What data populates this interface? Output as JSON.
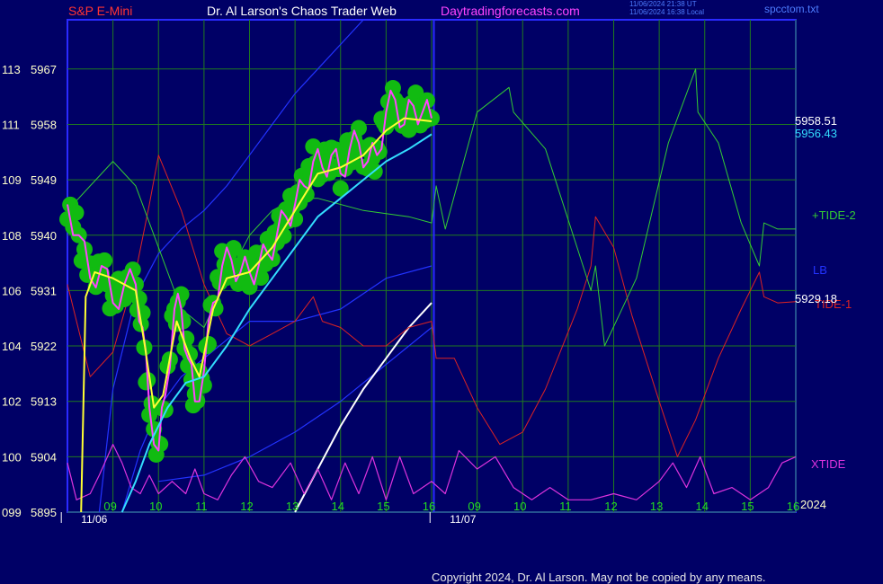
{
  "header": {
    "symbol": "S&P E-Mini",
    "author": "Dr. Al Larson's Chaos Trader Web",
    "site": "Daytradingforecasts.com",
    "stamp_utc": "11/06/2024 21:38 UT",
    "stamp_local": "11/06/2024 16:38 Local",
    "file": "spcctom.txt"
  },
  "copyright": "Copyright 2024, Dr. Al Larson. May not be copied by any means.",
  "colors": {
    "background": "#000066",
    "frame": "#2a2aff",
    "grid": "#1f7a1f",
    "price_bars": "#ff44ff",
    "price_glow": "#11bb11",
    "average_fast": "#ffff33",
    "average_slow": "#33ddff",
    "plus_tide": "#33cc33",
    "minus_tide": "#dd2222",
    "xtide": "#dd33dd",
    "lb": "#2233ff",
    "extension": "#ffffff",
    "axis_text": "#ffffcc"
  },
  "chart_data": {
    "type": "line",
    "y_ticks": [
      {
        "left": "099",
        "price": 5895
      },
      {
        "left": "100",
        "price": 5904
      },
      {
        "left": "102",
        "price": 5913
      },
      {
        "left": "104",
        "price": 5922
      },
      {
        "left": "106",
        "price": 5931
      },
      {
        "left": "108",
        "price": 5940
      },
      {
        "left": "109",
        "price": 5949
      },
      {
        "left": "111",
        "price": 5958
      },
      {
        "left": "113",
        "price": 5967
      }
    ],
    "ylim": [
      5895,
      5975
    ],
    "xlim": [
      8.0,
      24.0
    ],
    "hour_ticks": [
      {
        "x": 9,
        "label": "09"
      },
      {
        "x": 10,
        "label": "10"
      },
      {
        "x": 11,
        "label": "11"
      },
      {
        "x": 12,
        "label": "12"
      },
      {
        "x": 13,
        "label": "13"
      },
      {
        "x": 14,
        "label": "14"
      },
      {
        "x": 15,
        "label": "15"
      },
      {
        "x": 16,
        "label": "16"
      },
      {
        "x": 17,
        "label": "09"
      },
      {
        "x": 18,
        "label": "10"
      },
      {
        "x": 19,
        "label": "11"
      },
      {
        "x": 20,
        "label": "12"
      },
      {
        "x": 21,
        "label": "13"
      },
      {
        "x": 22,
        "label": "14"
      },
      {
        "x": 23,
        "label": "15"
      },
      {
        "x": 24,
        "label": "16"
      }
    ],
    "day_labels": [
      {
        "x": 8.3,
        "label": "11/06"
      },
      {
        "x": 16.4,
        "label": "11/07"
      }
    ],
    "day_divider_x": 16.05,
    "year_label": "2024",
    "price_series": [
      {
        "x": 8.0,
        "y": 5945
      },
      {
        "x": 8.25,
        "y": 5940
      },
      {
        "x": 8.5,
        "y": 5933
      },
      {
        "x": 8.75,
        "y": 5935
      },
      {
        "x": 9.0,
        "y": 5929
      },
      {
        "x": 9.25,
        "y": 5932
      },
      {
        "x": 9.5,
        "y": 5932
      },
      {
        "x": 9.65,
        "y": 5925
      },
      {
        "x": 9.8,
        "y": 5912
      },
      {
        "x": 10.0,
        "y": 5905
      },
      {
        "x": 10.15,
        "y": 5914
      },
      {
        "x": 10.35,
        "y": 5928
      },
      {
        "x": 10.5,
        "y": 5928
      },
      {
        "x": 10.65,
        "y": 5920
      },
      {
        "x": 10.8,
        "y": 5913
      },
      {
        "x": 11.0,
        "y": 5918
      },
      {
        "x": 11.2,
        "y": 5929
      },
      {
        "x": 11.4,
        "y": 5935
      },
      {
        "x": 11.6,
        "y": 5936
      },
      {
        "x": 11.8,
        "y": 5934
      },
      {
        "x": 12.0,
        "y": 5934
      },
      {
        "x": 12.2,
        "y": 5935
      },
      {
        "x": 12.4,
        "y": 5937
      },
      {
        "x": 12.6,
        "y": 5940
      },
      {
        "x": 12.8,
        "y": 5943
      },
      {
        "x": 13.0,
        "y": 5945
      },
      {
        "x": 13.2,
        "y": 5948
      },
      {
        "x": 13.4,
        "y": 5952
      },
      {
        "x": 13.6,
        "y": 5951
      },
      {
        "x": 13.8,
        "y": 5953
      },
      {
        "x": 14.0,
        "y": 5950
      },
      {
        "x": 14.2,
        "y": 5954
      },
      {
        "x": 14.4,
        "y": 5955
      },
      {
        "x": 14.6,
        "y": 5952
      },
      {
        "x": 14.8,
        "y": 5953
      },
      {
        "x": 15.0,
        "y": 5960
      },
      {
        "x": 15.2,
        "y": 5962
      },
      {
        "x": 15.4,
        "y": 5958
      },
      {
        "x": 15.6,
        "y": 5961
      },
      {
        "x": 15.8,
        "y": 5960
      },
      {
        "x": 16.0,
        "y": 5959
      }
    ],
    "average_fast": [
      {
        "x": 8.3,
        "y": 5895
      },
      {
        "x": 8.4,
        "y": 5930
      },
      {
        "x": 8.6,
        "y": 5934
      },
      {
        "x": 9.0,
        "y": 5933
      },
      {
        "x": 9.5,
        "y": 5931
      },
      {
        "x": 9.7,
        "y": 5922
      },
      {
        "x": 9.9,
        "y": 5912
      },
      {
        "x": 10.1,
        "y": 5914
      },
      {
        "x": 10.4,
        "y": 5926
      },
      {
        "x": 10.7,
        "y": 5920
      },
      {
        "x": 10.9,
        "y": 5917
      },
      {
        "x": 11.2,
        "y": 5928
      },
      {
        "x": 11.5,
        "y": 5933
      },
      {
        "x": 12.0,
        "y": 5934
      },
      {
        "x": 12.5,
        "y": 5938
      },
      {
        "x": 13.0,
        "y": 5944
      },
      {
        "x": 13.5,
        "y": 5950
      },
      {
        "x": 14.0,
        "y": 5951
      },
      {
        "x": 14.5,
        "y": 5953
      },
      {
        "x": 15.0,
        "y": 5957
      },
      {
        "x": 15.4,
        "y": 5959
      },
      {
        "x": 16.0,
        "y": 5958.5
      }
    ],
    "average_slow": [
      {
        "x": 9.2,
        "y": 5895
      },
      {
        "x": 9.5,
        "y": 5900
      },
      {
        "x": 9.8,
        "y": 5906
      },
      {
        "x": 10.2,
        "y": 5912
      },
      {
        "x": 10.6,
        "y": 5916
      },
      {
        "x": 11.0,
        "y": 5917
      },
      {
        "x": 11.5,
        "y": 5922
      },
      {
        "x": 12.0,
        "y": 5928
      },
      {
        "x": 12.5,
        "y": 5933
      },
      {
        "x": 13.0,
        "y": 5938
      },
      {
        "x": 13.5,
        "y": 5943
      },
      {
        "x": 14.0,
        "y": 5946
      },
      {
        "x": 14.5,
        "y": 5949
      },
      {
        "x": 15.0,
        "y": 5952
      },
      {
        "x": 15.5,
        "y": 5954
      },
      {
        "x": 16.0,
        "y": 5956.4
      }
    ],
    "plus_tide": [
      {
        "x": 8.0,
        "y": 5944
      },
      {
        "x": 8.5,
        "y": 5948
      },
      {
        "x": 9.0,
        "y": 5952
      },
      {
        "x": 9.5,
        "y": 5948
      },
      {
        "x": 10.0,
        "y": 5938
      },
      {
        "x": 10.5,
        "y": 5928
      },
      {
        "x": 11.0,
        "y": 5925
      },
      {
        "x": 11.5,
        "y": 5933
      },
      {
        "x": 12.0,
        "y": 5940
      },
      {
        "x": 12.5,
        "y": 5944
      },
      {
        "x": 13.0,
        "y": 5946
      },
      {
        "x": 13.5,
        "y": 5946
      },
      {
        "x": 14.5,
        "y": 5944
      },
      {
        "x": 15.5,
        "y": 5943
      },
      {
        "x": 16.0,
        "y": 5942
      },
      {
        "x": 16.1,
        "y": 5948
      },
      {
        "x": 16.3,
        "y": 5941
      },
      {
        "x": 17.0,
        "y": 5960
      },
      {
        "x": 17.7,
        "y": 5964
      },
      {
        "x": 17.8,
        "y": 5960
      },
      {
        "x": 18.5,
        "y": 5954
      },
      {
        "x": 19.5,
        "y": 5931
      },
      {
        "x": 19.6,
        "y": 5935
      },
      {
        "x": 19.8,
        "y": 5922
      },
      {
        "x": 20.5,
        "y": 5933
      },
      {
        "x": 21.2,
        "y": 5955
      },
      {
        "x": 21.8,
        "y": 5967
      },
      {
        "x": 21.85,
        "y": 5960
      },
      {
        "x": 22.3,
        "y": 5955
      },
      {
        "x": 22.8,
        "y": 5942
      },
      {
        "x": 23.2,
        "y": 5935
      },
      {
        "x": 23.3,
        "y": 5942
      },
      {
        "x": 23.6,
        "y": 5941
      },
      {
        "x": 24.0,
        "y": 5941
      }
    ],
    "minus_tide": [
      {
        "x": 8.0,
        "y": 5932
      },
      {
        "x": 8.5,
        "y": 5917
      },
      {
        "x": 9.0,
        "y": 5921
      },
      {
        "x": 9.5,
        "y": 5934
      },
      {
        "x": 9.8,
        "y": 5945
      },
      {
        "x": 10.0,
        "y": 5953
      },
      {
        "x": 10.5,
        "y": 5944
      },
      {
        "x": 11.0,
        "y": 5932
      },
      {
        "x": 11.5,
        "y": 5924
      },
      {
        "x": 12.0,
        "y": 5922
      },
      {
        "x": 12.5,
        "y": 5924
      },
      {
        "x": 13.0,
        "y": 5926
      },
      {
        "x": 13.4,
        "y": 5930
      },
      {
        "x": 13.6,
        "y": 5926
      },
      {
        "x": 14.0,
        "y": 5925
      },
      {
        "x": 14.5,
        "y": 5922
      },
      {
        "x": 15.0,
        "y": 5922
      },
      {
        "x": 15.5,
        "y": 5925
      },
      {
        "x": 16.0,
        "y": 5926
      },
      {
        "x": 16.1,
        "y": 5920
      },
      {
        "x": 16.5,
        "y": 5920
      },
      {
        "x": 17.0,
        "y": 5912
      },
      {
        "x": 17.5,
        "y": 5906
      },
      {
        "x": 18.0,
        "y": 5908
      },
      {
        "x": 18.5,
        "y": 5915
      },
      {
        "x": 19.2,
        "y": 5928
      },
      {
        "x": 19.5,
        "y": 5935
      },
      {
        "x": 19.6,
        "y": 5943
      },
      {
        "x": 20.0,
        "y": 5938
      },
      {
        "x": 20.4,
        "y": 5927
      },
      {
        "x": 21.0,
        "y": 5913
      },
      {
        "x": 21.4,
        "y": 5904
      },
      {
        "x": 21.8,
        "y": 5910
      },
      {
        "x": 22.3,
        "y": 5920
      },
      {
        "x": 22.8,
        "y": 5928
      },
      {
        "x": 23.2,
        "y": 5934
      },
      {
        "x": 23.3,
        "y": 5930
      },
      {
        "x": 23.6,
        "y": 5929
      },
      {
        "x": 24.0,
        "y": 5929.2
      }
    ],
    "xtide": [
      {
        "x": 8.0,
        "y": 5903
      },
      {
        "x": 8.2,
        "y": 5897
      },
      {
        "x": 8.5,
        "y": 5898
      },
      {
        "x": 8.7,
        "y": 5901
      },
      {
        "x": 9.0,
        "y": 5906
      },
      {
        "x": 9.2,
        "y": 5903
      },
      {
        "x": 9.4,
        "y": 5899
      },
      {
        "x": 9.6,
        "y": 5898
      },
      {
        "x": 9.8,
        "y": 5901
      },
      {
        "x": 10.0,
        "y": 5898
      },
      {
        "x": 10.3,
        "y": 5900
      },
      {
        "x": 10.6,
        "y": 5898
      },
      {
        "x": 10.8,
        "y": 5902
      },
      {
        "x": 11.0,
        "y": 5898
      },
      {
        "x": 11.3,
        "y": 5897
      },
      {
        "x": 11.6,
        "y": 5901
      },
      {
        "x": 11.9,
        "y": 5904
      },
      {
        "x": 12.2,
        "y": 5900
      },
      {
        "x": 12.5,
        "y": 5899
      },
      {
        "x": 12.9,
        "y": 5903
      },
      {
        "x": 13.2,
        "y": 5898
      },
      {
        "x": 13.5,
        "y": 5902
      },
      {
        "x": 13.8,
        "y": 5897
      },
      {
        "x": 14.1,
        "y": 5903
      },
      {
        "x": 14.4,
        "y": 5898
      },
      {
        "x": 14.7,
        "y": 5904
      },
      {
        "x": 15.0,
        "y": 5897
      },
      {
        "x": 15.3,
        "y": 5904
      },
      {
        "x": 15.6,
        "y": 5898
      },
      {
        "x": 16.0,
        "y": 5900
      },
      {
        "x": 16.3,
        "y": 5898
      },
      {
        "x": 16.6,
        "y": 5905
      },
      {
        "x": 17.0,
        "y": 5902
      },
      {
        "x": 17.4,
        "y": 5904
      },
      {
        "x": 17.8,
        "y": 5899
      },
      {
        "x": 18.2,
        "y": 5897
      },
      {
        "x": 18.6,
        "y": 5899
      },
      {
        "x": 19.0,
        "y": 5897
      },
      {
        "x": 19.5,
        "y": 5897
      },
      {
        "x": 20.0,
        "y": 5898
      },
      {
        "x": 20.5,
        "y": 5897
      },
      {
        "x": 21.0,
        "y": 5900
      },
      {
        "x": 21.3,
        "y": 5903
      },
      {
        "x": 21.6,
        "y": 5899
      },
      {
        "x": 21.9,
        "y": 5904
      },
      {
        "x": 22.2,
        "y": 5898
      },
      {
        "x": 22.6,
        "y": 5899
      },
      {
        "x": 23.0,
        "y": 5897
      },
      {
        "x": 23.4,
        "y": 5899
      },
      {
        "x": 23.7,
        "y": 5903
      },
      {
        "x": 24.0,
        "y": 5904
      }
    ],
    "lb_upper": [
      {
        "x": 8.7,
        "y": 5895
      },
      {
        "x": 9.0,
        "y": 5915
      },
      {
        "x": 9.5,
        "y": 5930
      },
      {
        "x": 10.0,
        "y": 5937
      },
      {
        "x": 10.5,
        "y": 5941
      },
      {
        "x": 11.0,
        "y": 5944
      },
      {
        "x": 11.5,
        "y": 5948
      },
      {
        "x": 12.0,
        "y": 5953
      },
      {
        "x": 12.5,
        "y": 5958
      },
      {
        "x": 13.0,
        "y": 5963
      },
      {
        "x": 13.5,
        "y": 5967
      },
      {
        "x": 14.0,
        "y": 5971
      },
      {
        "x": 14.5,
        "y": 5975
      }
    ],
    "lb_lower": [
      {
        "x": 9.2,
        "y": 5895
      },
      {
        "x": 9.6,
        "y": 5905
      },
      {
        "x": 10.0,
        "y": 5912
      },
      {
        "x": 10.5,
        "y": 5917
      },
      {
        "x": 11.0,
        "y": 5920
      },
      {
        "x": 11.5,
        "y": 5923
      },
      {
        "x": 12.0,
        "y": 5926
      },
      {
        "x": 13.0,
        "y": 5926
      },
      {
        "x": 14.0,
        "y": 5928
      },
      {
        "x": 15.0,
        "y": 5933
      },
      {
        "x": 16.0,
        "y": 5935
      }
    ],
    "lb_bottom": [
      {
        "x": 10.0,
        "y": 5900
      },
      {
        "x": 11.0,
        "y": 5901
      },
      {
        "x": 12.0,
        "y": 5904
      },
      {
        "x": 13.0,
        "y": 5908
      },
      {
        "x": 14.0,
        "y": 5913
      },
      {
        "x": 15.0,
        "y": 5919
      },
      {
        "x": 16.0,
        "y": 5925
      }
    ],
    "extension": [
      {
        "x": 13.0,
        "y": 5895
      },
      {
        "x": 13.5,
        "y": 5902
      },
      {
        "x": 14.0,
        "y": 5909
      },
      {
        "x": 14.5,
        "y": 5915
      },
      {
        "x": 15.0,
        "y": 5920
      },
      {
        "x": 15.5,
        "y": 5925
      },
      {
        "x": 16.0,
        "y": 5929
      }
    ],
    "price_label_1": 5958.51,
    "price_label_2": 5956.43,
    "price_label_3": 5929.18,
    "series_labels": {
      "plus_tide": "+TIDE-2",
      "lb": "LB",
      "minus_tide": "TIDE-1",
      "xtide": "XTIDE"
    }
  }
}
